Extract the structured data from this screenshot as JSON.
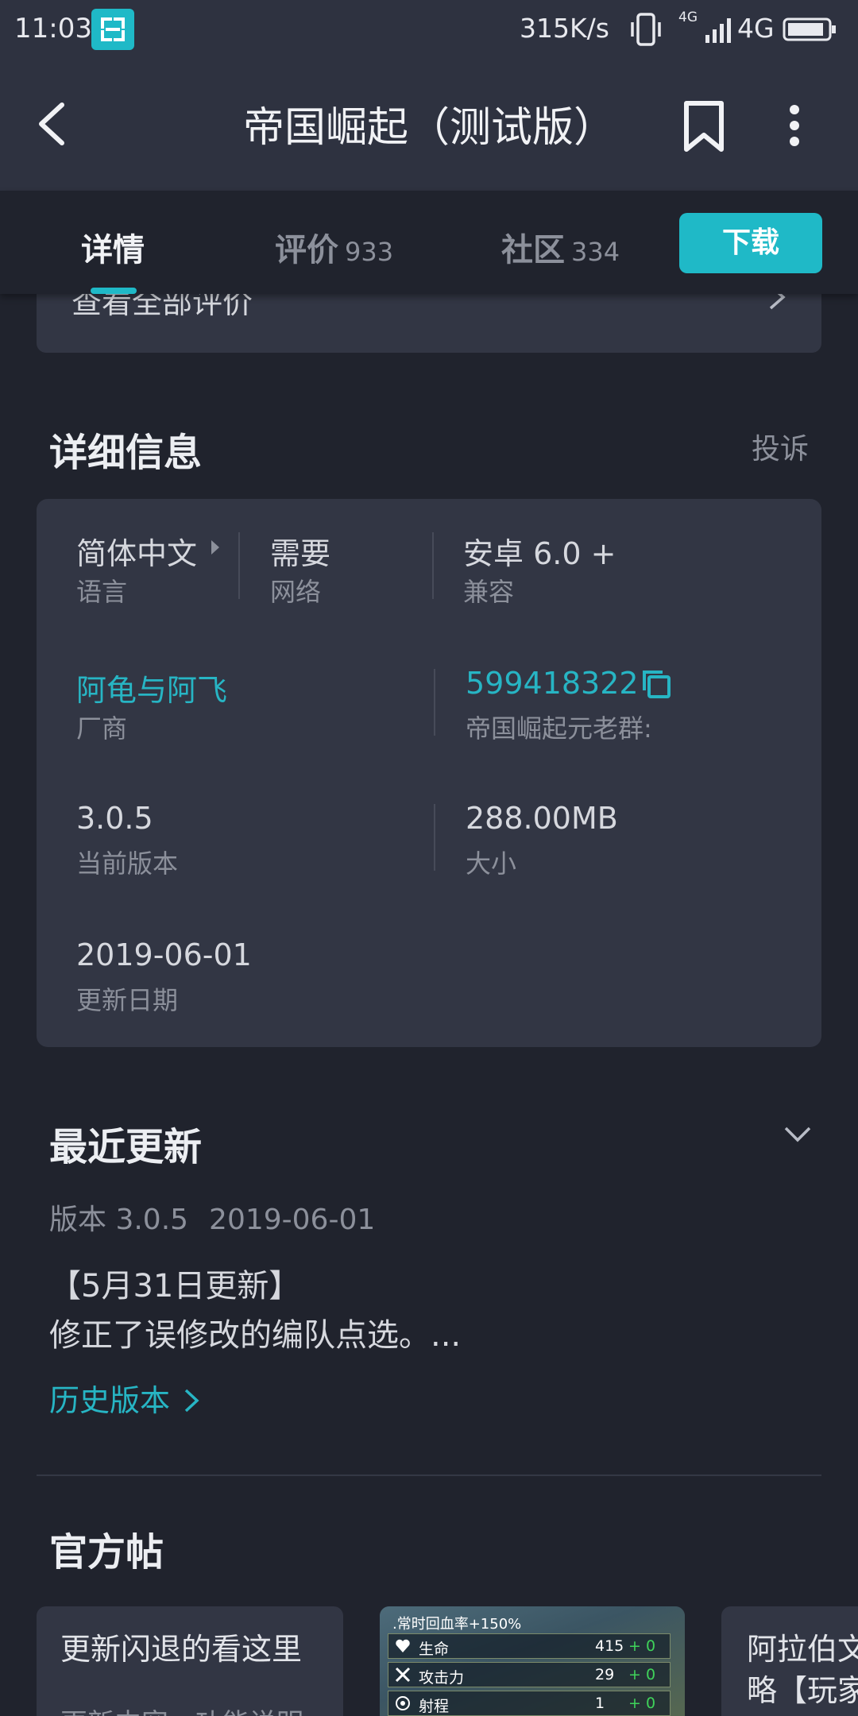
{
  "status_bar": {
    "time": "11:03",
    "speed": "315K/s",
    "signal_label": "4G",
    "network": "4G"
  },
  "header": {
    "title": "帝国崛起（测试版）"
  },
  "tabs": [
    {
      "label": "详情",
      "count": ""
    },
    {
      "label": "评价",
      "count": "933"
    },
    {
      "label": "社区",
      "count": "334"
    }
  ],
  "download_label": "下载",
  "reviews_card": {
    "label": "查看全部评价"
  },
  "details": {
    "title": "详细信息",
    "complain": "投诉",
    "items": {
      "language": {
        "value": "简体中文",
        "label": "语言"
      },
      "network": {
        "value": "需要",
        "label": "网络"
      },
      "compat": {
        "value": "安卓 6.0 +",
        "label": "兼容"
      },
      "vendor": {
        "value": "阿龟与阿飞",
        "label": "厂商"
      },
      "group": {
        "value": "599418322",
        "label": "帝国崛起元老群:"
      },
      "version": {
        "value": "3.0.5",
        "label": "当前版本"
      },
      "size": {
        "value": "288.00MB",
        "label": "大小"
      },
      "date": {
        "value": "2019-06-01",
        "label": "更新日期"
      }
    }
  },
  "recent_update": {
    "title": "最近更新",
    "version": "版本 3.0.5",
    "date": "2019-06-01",
    "notes_title": "【5月31日更新】",
    "notes_body": "修正了误修改的编队点选。...",
    "history_link": "历史版本"
  },
  "official_posts": {
    "title": "官方帖",
    "posts": [
      {
        "title": "更新闪退的看这里",
        "sub": "更新内容、功能说明"
      },
      {
        "screenshot_header": ".常时回血率+150%",
        "stats": [
          {
            "name": "生命",
            "value": "415",
            "bonus": "+ 0"
          },
          {
            "name": "攻击力",
            "value": "29",
            "bonus": "+ 0"
          },
          {
            "name": "射程",
            "value": "1",
            "bonus": "+ 0"
          }
        ]
      },
      {
        "title": "阿拉伯文\n略【玩家"
      }
    ]
  },
  "colors": {
    "accent": "#1fb9c7",
    "background": "#20232d",
    "card": "#323644"
  }
}
